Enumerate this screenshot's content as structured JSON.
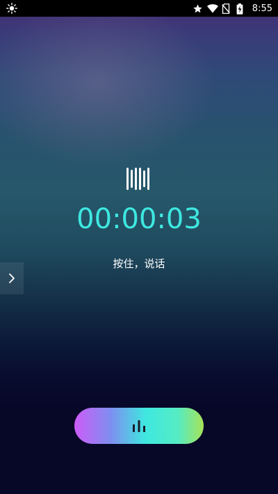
{
  "status_bar": {
    "time": "8:55",
    "icons": [
      "brightness-icon",
      "star-icon",
      "wifi-icon",
      "no-sim-icon",
      "battery-charging-icon"
    ]
  },
  "recorder": {
    "timer": "00:00:03",
    "hint": "按住，说话",
    "accent_color": "#3ee8e0",
    "state": "recording"
  },
  "side_tab": {
    "icon": "chevron-right-icon"
  },
  "record_button": {
    "icon": "bar-chart-icon",
    "gradient": [
      "#cc5cf8",
      "#3ee8e0",
      "#a6e258"
    ]
  }
}
